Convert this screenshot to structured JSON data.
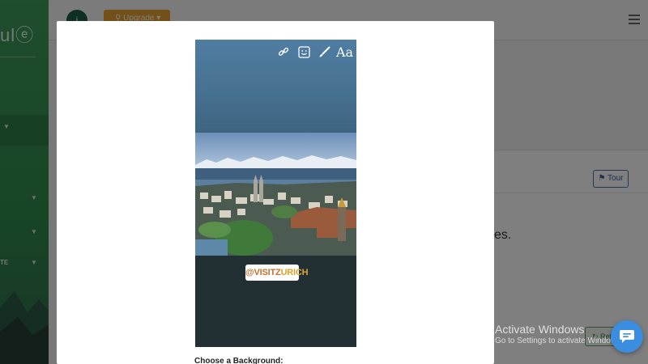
{
  "app": {
    "logo_text": "ulⓔ",
    "avatar_initial": "i",
    "upgrade_label": "Upgrade",
    "sidebar_label": "TE",
    "tour_label": "Tour",
    "partial_heading": "es.",
    "refresh_label": "Ref"
  },
  "watermark": {
    "title": "Activate Windows",
    "subtitle": "Go to Settings to activate Windows."
  },
  "modal": {
    "story": {
      "tools": [
        "link-icon",
        "sticker-icon",
        "brush-icon",
        "text-tool-icon"
      ],
      "text_tool_label": "Aa",
      "sticker_text": "@VISITZURICH"
    },
    "choose_background_label": "Choose a Background:"
  },
  "colors": {
    "sidebar_green": "#2f8a4c",
    "upgrade_orange": "#e6a030",
    "story_bottom": "#223033",
    "chat_blue": "#3b8de0"
  }
}
